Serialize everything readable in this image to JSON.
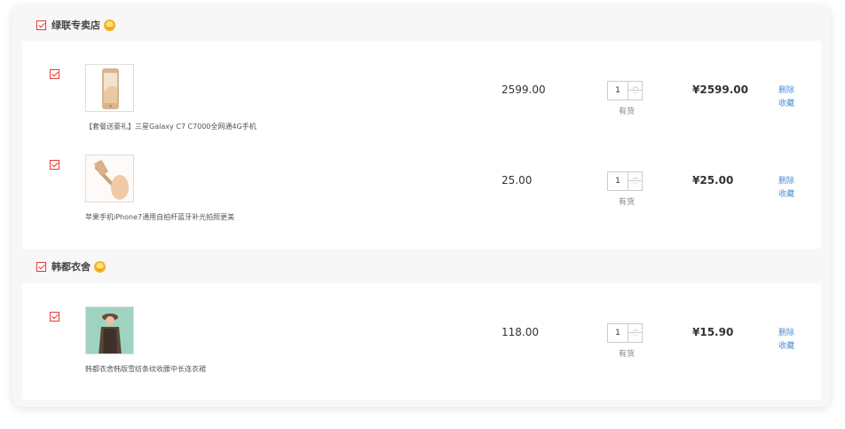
{
  "shops": [
    {
      "name": "绿联专卖店",
      "checked": true,
      "items": [
        {
          "name": "【套餐送豪礼】三星Galaxy C7 C7000全网通4G手机",
          "price": "2599.00",
          "qty": "1",
          "qty_up": "^",
          "qty_down": "v",
          "stock": "有货",
          "subtotal": "¥2599.00",
          "delete_label": "删除",
          "favorite_label": "收藏",
          "image": "phone-gold"
        },
        {
          "name": "苹果手机iPhone7通用自拍杆蓝牙补光拍照更美",
          "price": "25.00",
          "qty": "1",
          "qty_up": "^",
          "qty_down": "v",
          "stock": "有货",
          "subtotal": "¥25.00",
          "delete_label": "删除",
          "favorite_label": "收藏",
          "image": "selfie-stick"
        }
      ]
    },
    {
      "name": "韩都衣舍",
      "checked": true,
      "items": [
        {
          "name": "韩都衣舍韩版雪纺条纹收腰中长连衣裙",
          "price": "118.00",
          "qty": "1",
          "qty_up": "^",
          "qty_down": "v",
          "stock": "有货",
          "subtotal": "¥15.90",
          "delete_label": "删除",
          "favorite_label": "收藏",
          "image": "dress-model"
        }
      ]
    }
  ],
  "colors": {
    "checkbox": "#e4393c",
    "link": "#4a8fd6",
    "shop_bar": "#f7f7f7"
  }
}
